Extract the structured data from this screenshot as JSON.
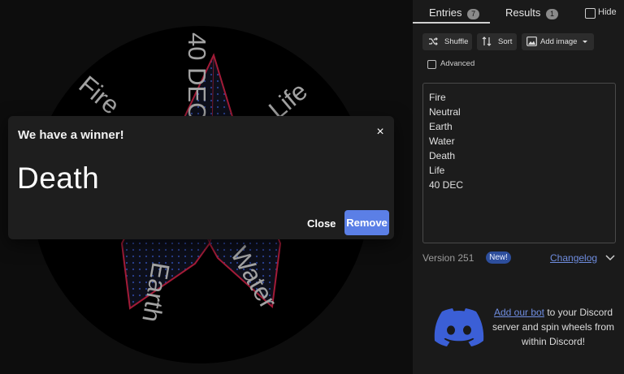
{
  "wheel": {
    "labels": [
      "Fire",
      "Neutral",
      "Earth",
      "Water",
      "Death",
      "Life",
      "40 DEC"
    ]
  },
  "dialog": {
    "title": "We have a winner!",
    "close_icon": "×",
    "winner": "Death",
    "close_label": "Close",
    "remove_label": "Remove"
  },
  "tabs": [
    {
      "label": "Entries",
      "count": "7"
    },
    {
      "label": "Results",
      "count": "1"
    }
  ],
  "hide_label": "Hide",
  "toolbar": {
    "shuffle": {
      "label": "Shuffle",
      "icon": "shuffle-icon"
    },
    "sort": {
      "label": "Sort",
      "icon": "sort-icon"
    },
    "add_image": {
      "label": "Add image",
      "icon": "image-icon"
    }
  },
  "advanced_label": "Advanced",
  "entries": [
    "Fire",
    "Neutral",
    "Earth",
    "Water",
    "Death",
    "Life",
    "40 DEC"
  ],
  "footer": {
    "version": "Version 251",
    "new_badge": "New!",
    "changelog": "Changelog"
  },
  "discord": {
    "link_text": "Add our bot",
    "text_rest": " to your Discord server and spin wheels from within Discord!"
  },
  "colors": {
    "accent": "#5b7fe6",
    "star_outline": "#d8254a",
    "badge": "#2d4e9c"
  }
}
